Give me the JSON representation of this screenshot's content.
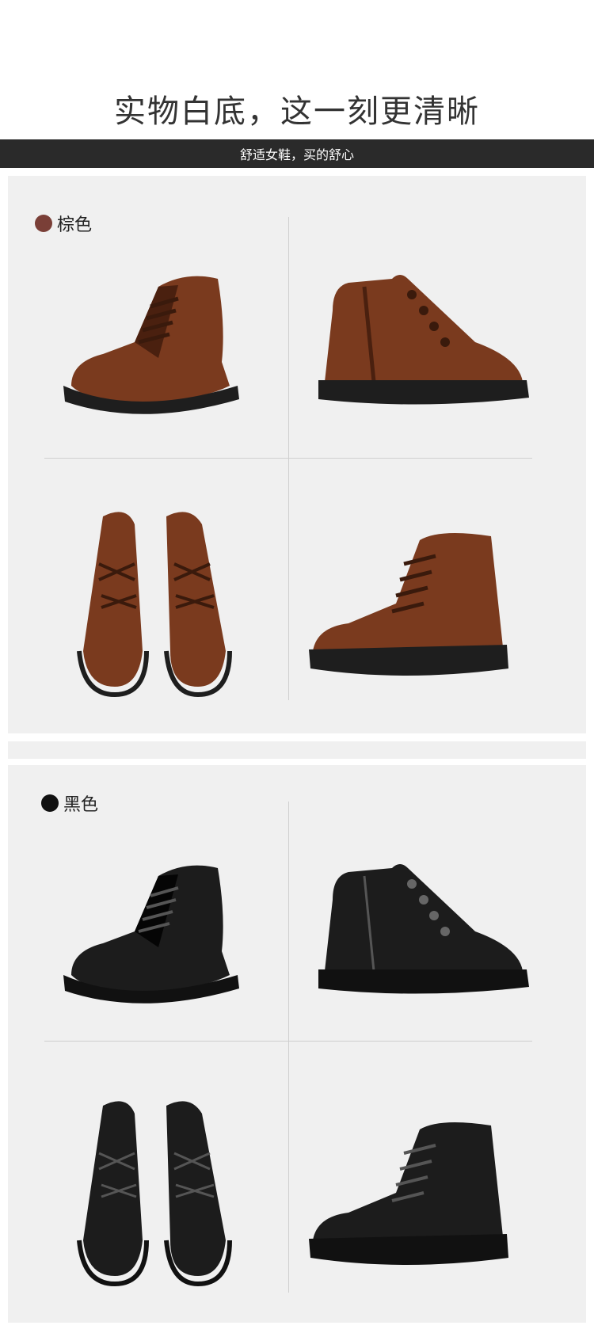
{
  "header": {
    "headline": "实物白底，这一刻更清晰",
    "banner": "舒适女鞋，买的舒心"
  },
  "variants": [
    {
      "label": "棕色",
      "swatch": "#7a3f37",
      "leather": "#7a3a1e",
      "leather_dark": "#4a200f",
      "lace": "#3a1a0c"
    },
    {
      "label": "黑色",
      "swatch": "#111111",
      "leather": "#1c1c1c",
      "leather_dark": "#050505",
      "lace": "#0a0a0a"
    }
  ],
  "colors": {
    "sole": "#1e1e1e",
    "panel_bg": "#f0f0f0",
    "banner_bg": "#2a2a2a",
    "divider": "#cfcfcf"
  }
}
